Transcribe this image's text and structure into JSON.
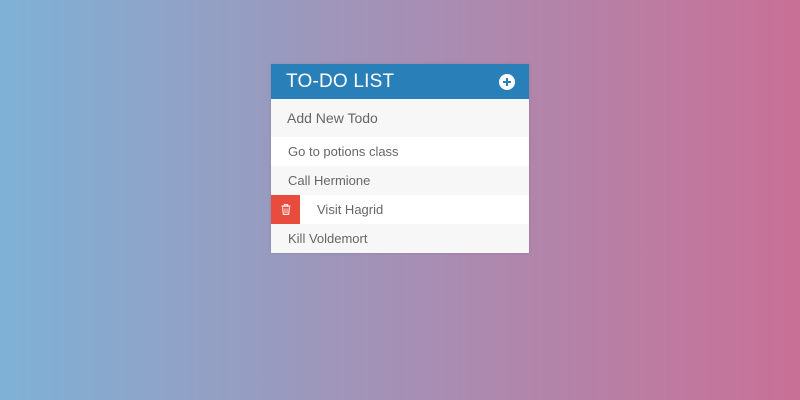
{
  "header": {
    "title": "TO-DO LIST",
    "add_icon": "plus-circle-icon"
  },
  "input": {
    "placeholder": "Add New Todo"
  },
  "todos": [
    {
      "text": "Go to potions class",
      "hovered": false
    },
    {
      "text": "Call Hermione",
      "hovered": false
    },
    {
      "text": "Visit Hagrid",
      "hovered": true,
      "delete_icon": "trash-icon"
    },
    {
      "text": "Kill Voldemort",
      "hovered": false
    }
  ],
  "colors": {
    "header_bg": "#2980b9",
    "delete_bg": "#e74c3c",
    "gradient_left": "#7fb1d6",
    "gradient_right": "#c97096"
  }
}
